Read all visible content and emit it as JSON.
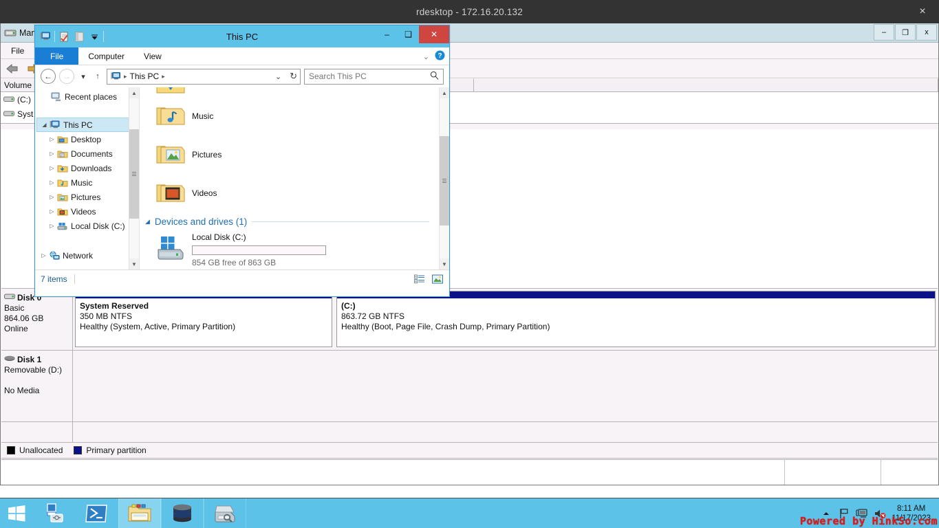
{
  "rdesktop": {
    "title": "rdesktop - 172.16.20.132",
    "close_label": "×"
  },
  "disk_management": {
    "title": "Management",
    "window_buttons": {
      "minimize": "–",
      "restore": "❐",
      "close": "x"
    },
    "menu": [
      "File"
    ],
    "columns": [
      "Volume"
    ],
    "volumes": [
      {
        "name": "(C:)"
      },
      {
        "name": "Syst"
      }
    ],
    "disks": [
      {
        "label": "Disk 0",
        "type": "Basic",
        "size": "864.06 GB",
        "status": "Online",
        "partitions": [
          {
            "name": "System Reserved",
            "size": "350 MB NTFS",
            "status": "Healthy (System, Active, Primary Partition)",
            "color": "#0b1288",
            "width_pct": 28
          },
          {
            "name": "(C:)",
            "size": "863.72 GB NTFS",
            "status": "Healthy (Boot, Page File, Crash Dump, Primary Partition)",
            "color": "#0b1288",
            "width_pct": 72
          }
        ]
      },
      {
        "label": "Disk 1",
        "type": "Removable (D:)",
        "size": "",
        "status": "No Media",
        "partitions": []
      }
    ],
    "legend": [
      {
        "label": "Unallocated",
        "color": "#000000"
      },
      {
        "label": "Primary partition",
        "color": "#0b1288"
      }
    ]
  },
  "explorer": {
    "title": "This PC",
    "window_buttons": {
      "minimize": "–",
      "maximize": "❑",
      "close": "✕"
    },
    "ribbon_tabs": [
      "File",
      "Computer",
      "View"
    ],
    "ribbon_right": {
      "expand": "⌄",
      "help": "?"
    },
    "nav": {
      "back": "←",
      "forward": "→",
      "recent": "▾",
      "up": "↑",
      "refresh": "↻",
      "dropdown": "⌄"
    },
    "address": {
      "value": "This PC",
      "separator": "▸"
    },
    "search": {
      "placeholder": "Search This PC"
    },
    "tree": [
      {
        "label": "Recent places",
        "icon": "recent-places-icon",
        "indent": 22,
        "twisty": "",
        "selected": false
      },
      {
        "label": "This PC",
        "icon": "this-pc-icon",
        "indent": 6,
        "twisty": "◢",
        "selected": true
      },
      {
        "label": "Desktop",
        "icon": "folder-desktop-icon",
        "indent": 20,
        "twisty": "▷",
        "selected": false
      },
      {
        "label": "Documents",
        "icon": "folder-documents-icon",
        "indent": 20,
        "twisty": "▷",
        "selected": false
      },
      {
        "label": "Downloads",
        "icon": "folder-downloads-icon",
        "indent": 20,
        "twisty": "▷",
        "selected": false
      },
      {
        "label": "Music",
        "icon": "folder-music-icon",
        "indent": 20,
        "twisty": "▷",
        "selected": false
      },
      {
        "label": "Pictures",
        "icon": "folder-pictures-icon",
        "indent": 20,
        "twisty": "▷",
        "selected": false
      },
      {
        "label": "Videos",
        "icon": "folder-videos-icon",
        "indent": 20,
        "twisty": "▷",
        "selected": false
      },
      {
        "label": "Local Disk (C:)",
        "icon": "local-disk-icon",
        "indent": 20,
        "twisty": "▷",
        "selected": false
      },
      {
        "label": "Network",
        "icon": "network-icon",
        "indent": 6,
        "twisty": "▷",
        "selected": false
      }
    ],
    "items": [
      {
        "label": "Music",
        "icon": "folder-music-icon"
      },
      {
        "label": "Pictures",
        "icon": "folder-pictures-icon"
      },
      {
        "label": "Videos",
        "icon": "folder-videos-icon"
      }
    ],
    "group": {
      "title": "Devices and drives (1)",
      "twisty": "◢"
    },
    "drives": [
      {
        "name": "Local Disk (C:)",
        "free": "854 GB free of 863 GB",
        "used_pct": 1
      }
    ],
    "status": {
      "items": "7 items"
    },
    "view_buttons": [
      {
        "name": "details-view-icon"
      },
      {
        "name": "large-icons-view-icon"
      }
    ]
  },
  "taskbar": {
    "start": "start-button",
    "items": [
      {
        "name": "server-manager-icon",
        "active": false
      },
      {
        "name": "powershell-icon",
        "active": false
      },
      {
        "name": "file-explorer-icon",
        "active": true
      },
      {
        "name": "database-icon",
        "active": false
      },
      {
        "name": "disk-management-icon",
        "active": false
      }
    ],
    "tray": {
      "show_hidden": "▲",
      "network_icon": "network-flag-icon",
      "monitor_icon": "remote-monitor-icon",
      "volume_icon": "volume-muted-icon",
      "time": "8:11 AM",
      "date": "11/17/2023"
    },
    "watermark": "Powered by HinkSo.com"
  }
}
